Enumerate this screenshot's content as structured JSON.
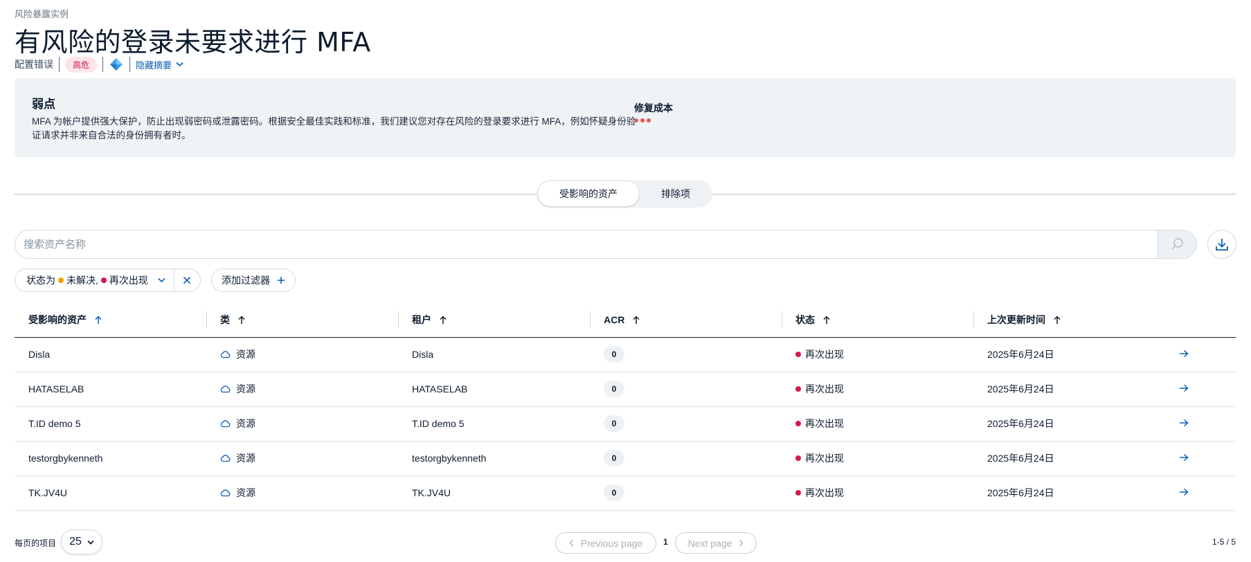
{
  "header": {
    "kicker": "风险暴露实例",
    "title": "有风险的登录未要求进行 MFA",
    "category": "配置错误",
    "severity": "高危",
    "summary_toggle": "隐藏摘要",
    "colors": {
      "severity_bg": "#fde5ea",
      "severity_fg": "#d0103a",
      "link": "#0a5fb4"
    }
  },
  "weakness": {
    "title": "弱点",
    "description": "MFA 为帐户提供强大保护，防止出现弱密码或泄露密码。根据安全最佳实践和标准，我们建议您对存在风险的登录要求进行 MFA，例如怀疑身份验证请求并非来自合法的身份拥有者时。",
    "remediation_cost_label": "修复成本",
    "remediation_cost_level": 3,
    "cost_color": "#e8565a"
  },
  "tabs": {
    "active": "受影响的资产",
    "other": "排除项"
  },
  "search": {
    "placeholder": "搜索资产名称"
  },
  "filters": {
    "chip_prefix": "状态为",
    "values": [
      {
        "label": "未解决,",
        "color": "#f0a100"
      },
      {
        "label": "再次出现",
        "color": "#d6174a"
      }
    ],
    "add_filter": "添加过滤器"
  },
  "table": {
    "columns": [
      "受影响的资产",
      "类",
      "租户",
      "ACR",
      "状态",
      "上次更新时间"
    ],
    "rows": [
      {
        "asset": "Disla",
        "type": "资源",
        "tenant": "Disla",
        "acr": "0",
        "status": "再次出现",
        "updated": "2025年6月24日"
      },
      {
        "asset": "HATASELAB",
        "type": "资源",
        "tenant": "HATASELAB",
        "acr": "0",
        "status": "再次出现",
        "updated": "2025年6月24日"
      },
      {
        "asset": "T.ID demo 5",
        "type": "资源",
        "tenant": "T.ID demo 5",
        "acr": "0",
        "status": "再次出现",
        "updated": "2025年6月24日"
      },
      {
        "asset": "testorgbykenneth",
        "type": "资源",
        "tenant": "testorgbykenneth",
        "acr": "0",
        "status": "再次出现",
        "updated": "2025年6月24日"
      },
      {
        "asset": "TK.JV4U",
        "type": "资源",
        "tenant": "TK.JV4U",
        "acr": "0",
        "status": "再次出现",
        "updated": "2025年6月24日"
      }
    ],
    "status_color": "#d6174a",
    "link_color": "#0a5fb4"
  },
  "pagination": {
    "per_page_label": "每页的项目",
    "per_page": "25",
    "prev": "Previous page",
    "current": "1",
    "next": "Next page",
    "range": "1-5 / 5"
  }
}
